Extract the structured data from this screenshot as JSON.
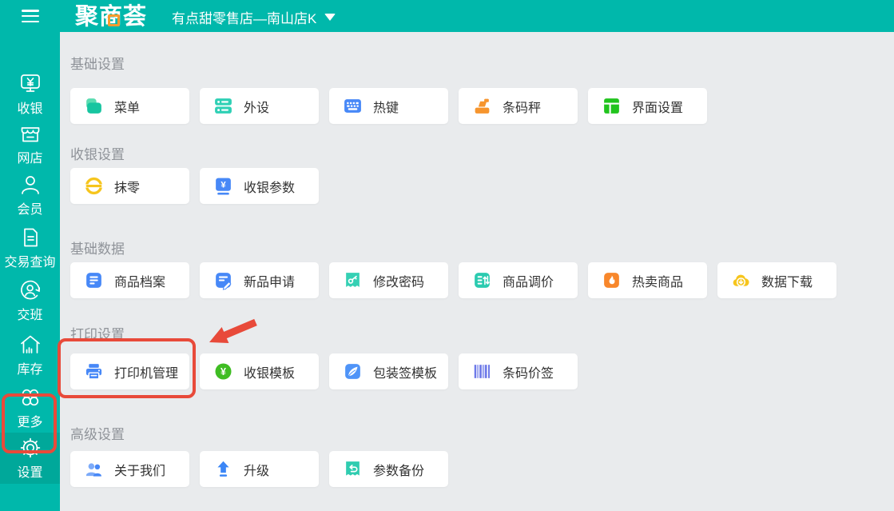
{
  "colors": {
    "primary_teal": "#00b8ab",
    "sidebar_selected_bg": "#00a89a",
    "content_background": "#e9ebed",
    "annotation_red": "#e84a3a",
    "section_title_gray": "#8f9399",
    "button_text": "#333333",
    "logo_accent_orange": "#f79b2e"
  },
  "header": {
    "logo": "聚商荟",
    "store_name": "有点甜零售店—南山店K"
  },
  "sidebar": {
    "items": [
      {
        "key": "cashier",
        "label": "收银",
        "icon": "cashier-monitor-icon",
        "selected": false
      },
      {
        "key": "online-store",
        "label": "网店",
        "icon": "storefront-icon",
        "selected": false
      },
      {
        "key": "member",
        "label": "会员",
        "icon": "person-icon",
        "selected": false
      },
      {
        "key": "transaction-query",
        "label": "交易查询",
        "icon": "document-icon",
        "selected": false
      },
      {
        "key": "shift",
        "label": "交班",
        "icon": "shift-rotate-icon",
        "selected": false
      },
      {
        "key": "inventory",
        "label": "库存",
        "icon": "warehouse-icon",
        "selected": false
      },
      {
        "key": "more",
        "label": "更多",
        "icon": "grid-circles-icon",
        "selected": false
      },
      {
        "key": "settings",
        "label": "设置",
        "icon": "gear-icon",
        "selected": true,
        "highlighted": true
      }
    ]
  },
  "main": {
    "sections": [
      {
        "title": "基础设置",
        "buttons": [
          {
            "key": "menu",
            "label": "菜单",
            "icon": "layers-icon",
            "color": "#17c5a0"
          },
          {
            "key": "peripherals",
            "label": "外设",
            "icon": "devices-icon",
            "color": "#2fd0b5"
          },
          {
            "key": "hotkeys",
            "label": "热键",
            "icon": "keyboard-icon",
            "color": "#4788f7"
          },
          {
            "key": "barcode-scale",
            "label": "条码秤",
            "icon": "scale-icon",
            "color": "#f6952e"
          },
          {
            "key": "ui-settings",
            "label": "界面设置",
            "icon": "layout-icon",
            "color": "#21c41e"
          }
        ]
      },
      {
        "title": "收银设置",
        "buttons": [
          {
            "key": "rounding",
            "label": "抹零",
            "icon": "coin-icon",
            "color": "#f6c51d"
          },
          {
            "key": "cashier-params",
            "label": "收银参数",
            "icon": "yuan-square-icon",
            "color": "#4788f7"
          }
        ]
      },
      {
        "title": "基础数据",
        "buttons": [
          {
            "key": "product-archive",
            "label": "商品档案",
            "icon": "list-doc-icon",
            "color": "#4788f7"
          },
          {
            "key": "new-product-request",
            "label": "新品申请",
            "icon": "edit-doc-icon",
            "color": "#4788f7"
          },
          {
            "key": "change-password",
            "label": "修改密码",
            "icon": "key-badge-icon",
            "color": "#35d0b4"
          },
          {
            "key": "price-adjust",
            "label": "商品调价",
            "icon": "price-list-icon",
            "color": "#2bcbb0"
          },
          {
            "key": "hot-products",
            "label": "热卖商品",
            "icon": "flame-icon",
            "color": "#f8872b"
          },
          {
            "key": "data-download",
            "label": "数据下载",
            "icon": "cloud-download-icon",
            "color": "#f6c51d"
          }
        ]
      },
      {
        "title": "打印设置",
        "buttons": [
          {
            "key": "printer-management",
            "label": "打印机管理",
            "icon": "printer-icon",
            "color": "#4788f7",
            "highlighted": true
          },
          {
            "key": "receipt-template",
            "label": "收银模板",
            "icon": "yuan-circle-icon",
            "color": "#3fbd23"
          },
          {
            "key": "package-label-template",
            "label": "包装签模板",
            "icon": "feather-icon",
            "color": "#4f94f8"
          },
          {
            "key": "barcode-price-tag",
            "label": "条码价签",
            "icon": "barcode-icon",
            "color": "#6d79e8"
          }
        ]
      },
      {
        "title": "高级设置",
        "buttons": [
          {
            "key": "about-us",
            "label": "关于我们",
            "icon": "people-icon",
            "color": "#4788f7"
          },
          {
            "key": "upgrade",
            "label": "升级",
            "icon": "arrow-up-icon",
            "color": "#3b86f6"
          },
          {
            "key": "param-backup",
            "label": "参数备份",
            "icon": "undo-badge-icon",
            "color": "#2fccb0"
          }
        ]
      }
    ]
  },
  "annotations": {
    "color": "#e84a3a",
    "highlighted_button": "打印机管理",
    "highlighted_sidebar_item": "设置",
    "arrow_target": "打印机管理"
  }
}
